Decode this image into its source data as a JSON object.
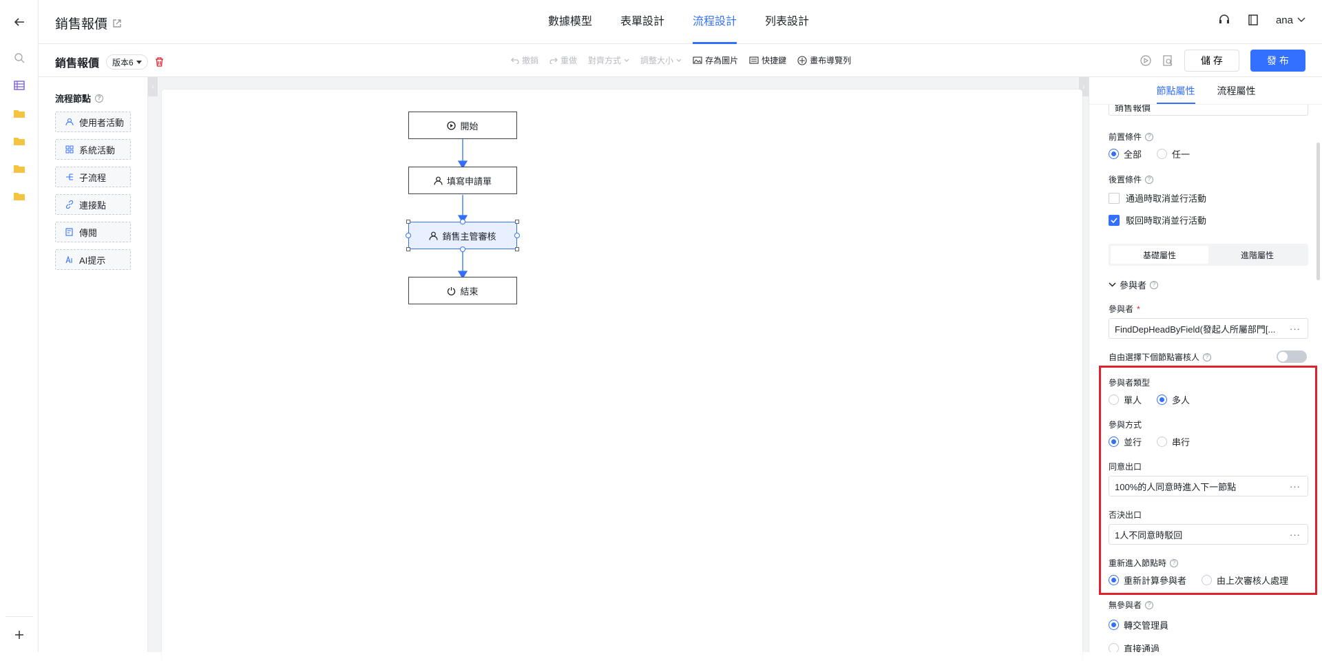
{
  "header": {
    "title": "銷售報價",
    "tabs": [
      {
        "label": "數據模型",
        "active": false
      },
      {
        "label": "表單設計",
        "active": false
      },
      {
        "label": "流程設計",
        "active": true
      },
      {
        "label": "列表設計",
        "active": false
      }
    ],
    "user": "ana"
  },
  "toolbar": {
    "process_name": "銷售報價",
    "version": "版本6",
    "tools": {
      "undo": "撤銷",
      "redo": "重做",
      "align": "對齊方式",
      "resize": "調整大小",
      "save_image": "存為圖片",
      "shortcuts": "快捷鍵",
      "canvas_nav": "畫布導覽列"
    },
    "save_label": "儲 存",
    "publish_label": "發 布"
  },
  "palette": {
    "title": "流程節點",
    "items": [
      {
        "label": "使用者活動",
        "icon": "user-icon"
      },
      {
        "label": "系統活動",
        "icon": "grid-icon"
      },
      {
        "label": "子流程",
        "icon": "subprocess-icon"
      },
      {
        "label": "連接點",
        "icon": "link-icon"
      },
      {
        "label": "傳閱",
        "icon": "circulate-icon"
      },
      {
        "label": "AI提示",
        "icon": "ai-icon"
      }
    ]
  },
  "flow": {
    "nodes": [
      {
        "label": "開始",
        "icon": "play-icon"
      },
      {
        "label": "填寫申請單",
        "icon": "user-icon"
      },
      {
        "label": "銷售主管審核",
        "icon": "user-icon",
        "selected": true
      },
      {
        "label": "結束",
        "icon": "power-icon"
      }
    ]
  },
  "panel": {
    "tabs": [
      {
        "label": "節點屬性",
        "active": true
      },
      {
        "label": "流程屬性",
        "active": false
      }
    ],
    "cut_field_value": "銷售報價",
    "precondition": {
      "label": "前置條件",
      "options": [
        {
          "label": "全部",
          "selected": true
        },
        {
          "label": "任一",
          "selected": false
        }
      ]
    },
    "postcondition": {
      "label": "後置條件",
      "options": [
        {
          "label": "通過時取消並行活動",
          "checked": false
        },
        {
          "label": "駁回時取消並行活動",
          "checked": true
        }
      ]
    },
    "segments": [
      {
        "label": "基礎屬性",
        "active": true
      },
      {
        "label": "進階屬性",
        "active": false
      }
    ],
    "participants_section": "參與者",
    "participant": {
      "label": "參與者",
      "required_mark": "*",
      "value": "FindDepHeadByField(發起人所屬部門[..."
    },
    "free_select": {
      "label": "自由選擇下個節點審核人",
      "on": false
    },
    "participant_type": {
      "label": "參與者類型",
      "options": [
        {
          "label": "單人",
          "selected": false
        },
        {
          "label": "多人",
          "selected": true
        }
      ]
    },
    "participation_mode": {
      "label": "參與方式",
      "options": [
        {
          "label": "並行",
          "selected": true
        },
        {
          "label": "串行",
          "selected": false
        }
      ]
    },
    "agree_exit": {
      "label": "同意出口",
      "value": "100%的人同意時進入下一節點"
    },
    "reject_exit": {
      "label": "否決出口",
      "value": "1人不同意時駁回"
    },
    "reenter": {
      "label": "重新進入節點時",
      "options": [
        {
          "label": "重新計算參與者",
          "selected": true
        },
        {
          "label": "由上次審核人處理",
          "selected": false
        }
      ]
    },
    "no_participant": {
      "label": "無參與者",
      "options": [
        {
          "label": "轉交管理員",
          "selected": true
        },
        {
          "label": "直接通過",
          "selected": false
        }
      ]
    }
  },
  "colors": {
    "accent": "#3370ff",
    "highlight_box": "#e0202b"
  }
}
